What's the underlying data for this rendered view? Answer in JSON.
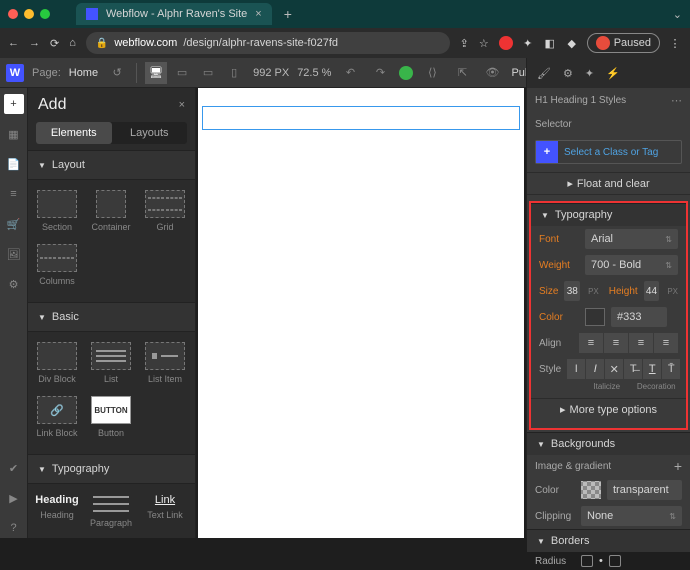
{
  "browser": {
    "tab_title": "Webflow - Alphr Raven's Site",
    "url_domain": "webflow.com",
    "url_path": "/design/alphr-ravens-site-f027fd",
    "paused": "Paused"
  },
  "topbar": {
    "page_label": "Page:",
    "page_name": "Home",
    "width": "992 PX",
    "zoom": "72.5 %",
    "publish": "Publish"
  },
  "add": {
    "title": "Add",
    "tabs": {
      "elements": "Elements",
      "layouts": "Layouts"
    },
    "sections": {
      "layout": "Layout",
      "basic": "Basic",
      "typography": "Typography"
    },
    "items": {
      "section": "Section",
      "container": "Container",
      "grid": "Grid",
      "columns": "Columns",
      "divblock": "Div Block",
      "list": "List",
      "listitem": "List Item",
      "linkblock": "Link Block",
      "button_lbl": "Button",
      "button_box": "BUTTON",
      "heading": "Heading",
      "heading_v": "Heading",
      "paragraph": "Paragraph",
      "textlink": "Text Link",
      "link_v": "Link"
    }
  },
  "style": {
    "selector_title": "H1  Heading 1 Styles",
    "selector_label": "Selector",
    "select_placeholder": "Select a Class or Tag",
    "float_clear": "Float and clear",
    "typography": "Typography",
    "font_lbl": "Font",
    "font_val": "Arial",
    "weight_lbl": "Weight",
    "weight_val": "700 - Bold",
    "size_lbl": "Size",
    "size_val": "38",
    "height_lbl": "Height",
    "height_val": "44",
    "px": "PX",
    "color_lbl": "Color",
    "color_val": "#333",
    "align_lbl": "Align",
    "style_lbl": "Style",
    "italicize": "Italicize",
    "decoration": "Decoration",
    "more_type": "More type options",
    "backgrounds": "Backgrounds",
    "img_grad": "Image & gradient",
    "bg_color_lbl": "Color",
    "transparent": "transparent",
    "clipping": "Clipping",
    "none": "None",
    "borders": "Borders",
    "radius": "Radius"
  }
}
